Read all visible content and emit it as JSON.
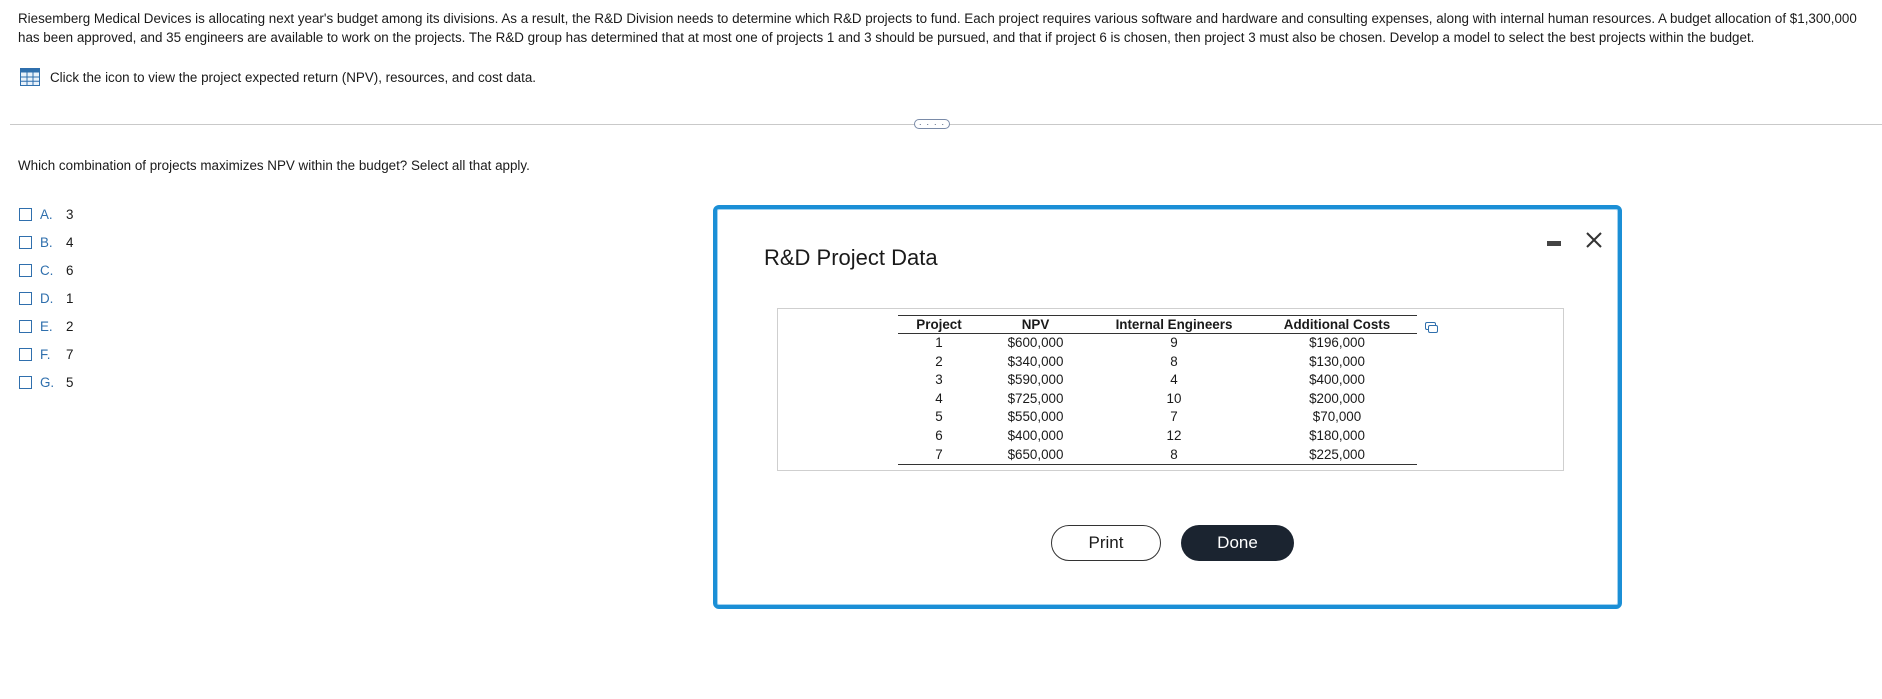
{
  "problem_text": "Riesemberg Medical Devices is allocating next year's budget among its divisions. As a result, the R&D Division needs to determine which R&D projects to fund. Each project requires various software and hardware and consulting expenses, along with internal human resources. A budget allocation of $1,300,000 has been approved, and 35 engineers are available to work on the projects. The R&D group has determined that at most one of projects 1 and 3 should be pursued, and that if project 6 is chosen, then project 3 must also be chosen. Develop a model to select the best projects within the budget.",
  "data_link_text": "Click the icon to view the project expected return (NPV), resources, and cost data.",
  "more_button": "· · · ·",
  "question": "Which combination of projects maximizes NPV within the budget? Select all that apply.",
  "options": [
    {
      "letter": "A.",
      "value": "3"
    },
    {
      "letter": "B.",
      "value": "4"
    },
    {
      "letter": "C.",
      "value": "6"
    },
    {
      "letter": "D.",
      "value": "1"
    },
    {
      "letter": "E.",
      "value": "2"
    },
    {
      "letter": "F.",
      "value": "7"
    },
    {
      "letter": "G.",
      "value": "5"
    }
  ],
  "modal": {
    "title": "R&D Project Data",
    "columns": [
      "Project",
      "NPV",
      "Internal Engineers",
      "Additional Costs"
    ],
    "rows": [
      [
        "1",
        "$600,000",
        "9",
        "$196,000"
      ],
      [
        "2",
        "$340,000",
        "8",
        "$130,000"
      ],
      [
        "3",
        "$590,000",
        "4",
        "$400,000"
      ],
      [
        "4",
        "$725,000",
        "10",
        "$200,000"
      ],
      [
        "5",
        "$550,000",
        "7",
        "$70,000"
      ],
      [
        "6",
        "$400,000",
        "12",
        "$180,000"
      ],
      [
        "7",
        "$650,000",
        "8",
        "$225,000"
      ]
    ],
    "print_label": "Print",
    "done_label": "Done"
  },
  "colors": {
    "accent": "#1b8fd6",
    "option_blue": "#2f6fad",
    "done_bg": "#1b2430"
  }
}
